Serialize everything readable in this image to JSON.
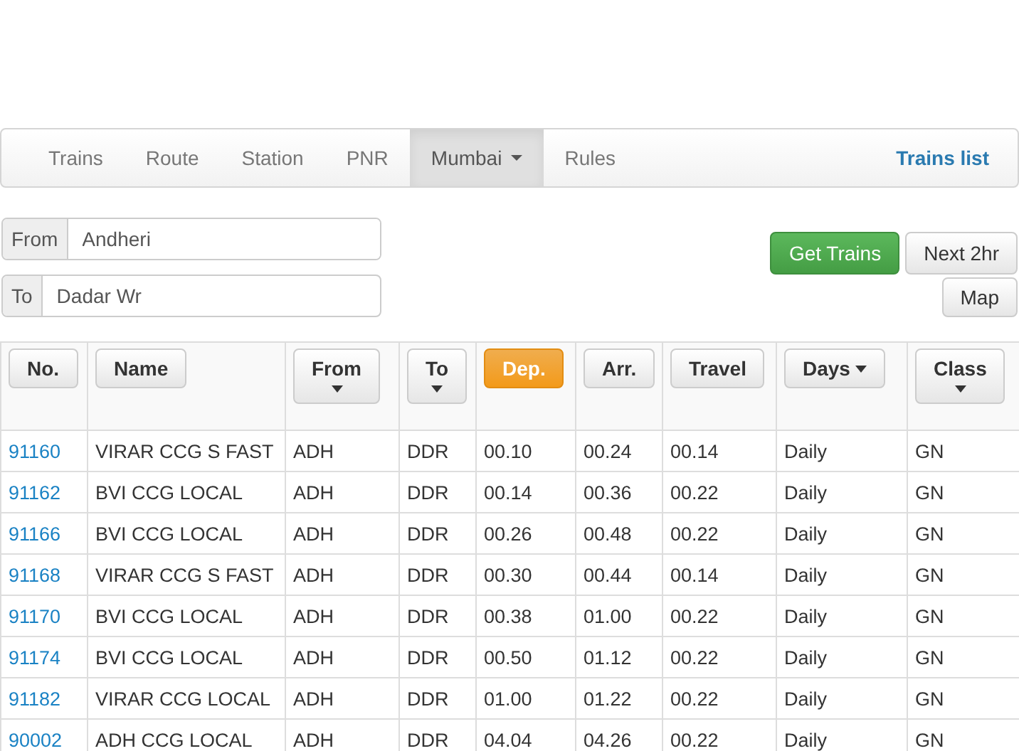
{
  "navbar": {
    "items": [
      {
        "label": "Trains",
        "selected": false,
        "dropdown": false
      },
      {
        "label": "Route",
        "selected": false,
        "dropdown": false
      },
      {
        "label": "Station",
        "selected": false,
        "dropdown": false
      },
      {
        "label": "PNR",
        "selected": false,
        "dropdown": false
      },
      {
        "label": "Mumbai",
        "selected": true,
        "dropdown": true
      },
      {
        "label": "Rules",
        "selected": false,
        "dropdown": false
      }
    ],
    "brand": "Trains list"
  },
  "form": {
    "from": {
      "label": "From",
      "value": "Andheri"
    },
    "to": {
      "label": "To",
      "value": "Dadar Wr"
    },
    "buttons": [
      {
        "label": "Get Trains",
        "kind": "primary"
      },
      {
        "label": "Next 2hr",
        "kind": "default"
      },
      {
        "label": "Map",
        "kind": "default"
      }
    ]
  },
  "table": {
    "columns": [
      {
        "label": "No.",
        "selected": false,
        "kind": "plain"
      },
      {
        "label": "Name",
        "selected": false,
        "kind": "plain"
      },
      {
        "label": "From",
        "selected": false,
        "kind": "caret-below"
      },
      {
        "label": "To",
        "selected": false,
        "kind": "caret-below"
      },
      {
        "label": "Dep.",
        "selected": true,
        "kind": "plain"
      },
      {
        "label": "Arr.",
        "selected": false,
        "kind": "plain"
      },
      {
        "label": "Travel",
        "selected": false,
        "kind": "plain"
      },
      {
        "label": "Days",
        "selected": false,
        "kind": "caret-inline"
      },
      {
        "label": "Class",
        "selected": false,
        "kind": "caret-below"
      }
    ],
    "rows": [
      [
        "91160",
        "VIRAR CCG S FAST",
        "ADH",
        "DDR",
        "00.10",
        "00.24",
        "00.14",
        "Daily",
        "GN"
      ],
      [
        "91162",
        "BVI CCG LOCAL",
        "ADH",
        "DDR",
        "00.14",
        "00.36",
        "00.22",
        "Daily",
        "GN"
      ],
      [
        "91166",
        "BVI CCG LOCAL",
        "ADH",
        "DDR",
        "00.26",
        "00.48",
        "00.22",
        "Daily",
        "GN"
      ],
      [
        "91168",
        "VIRAR CCG S FAST",
        "ADH",
        "DDR",
        "00.30",
        "00.44",
        "00.14",
        "Daily",
        "GN"
      ],
      [
        "91170",
        "BVI CCG LOCAL",
        "ADH",
        "DDR",
        "00.38",
        "01.00",
        "00.22",
        "Daily",
        "GN"
      ],
      [
        "91174",
        "BVI CCG LOCAL",
        "ADH",
        "DDR",
        "00.50",
        "01.12",
        "00.22",
        "Daily",
        "GN"
      ],
      [
        "91182",
        "VIRAR CCG LOCAL",
        "ADH",
        "DDR",
        "01.00",
        "01.22",
        "00.22",
        "Daily",
        "GN"
      ],
      [
        "90002",
        "ADH CCG LOCAL",
        "ADH",
        "DDR",
        "04.04",
        "04.26",
        "00.22",
        "Daily",
        "GN"
      ]
    ]
  }
}
